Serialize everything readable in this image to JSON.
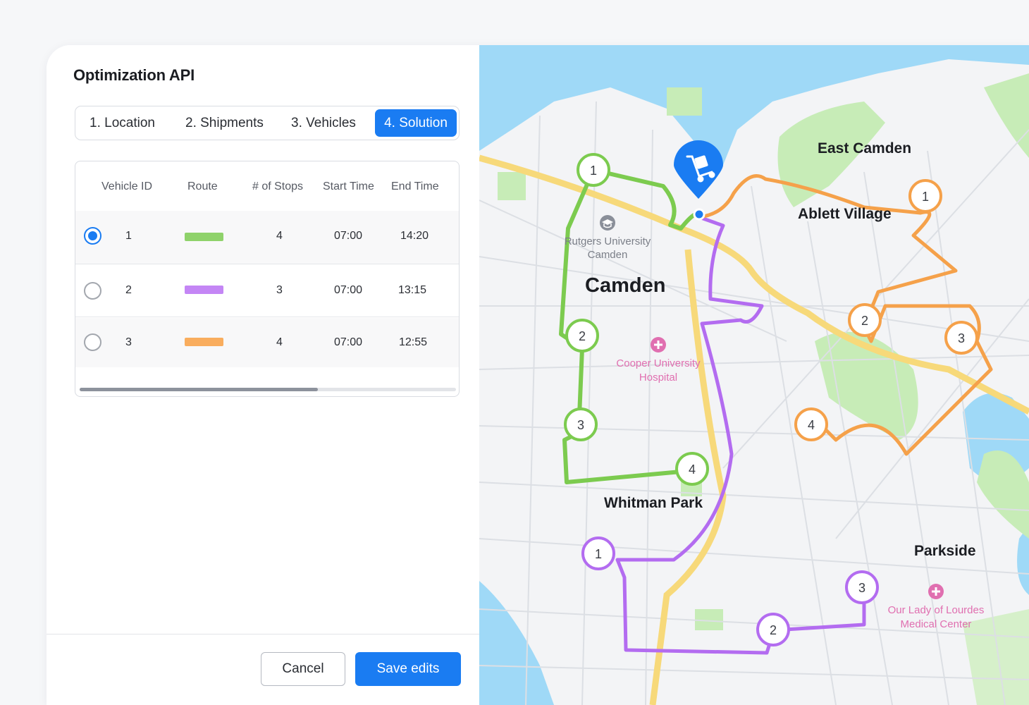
{
  "app": {
    "title": "Optimization API"
  },
  "tabs": [
    {
      "label": "1. Location"
    },
    {
      "label": "2. Shipments"
    },
    {
      "label": "3. Vehicles"
    },
    {
      "label": "4. Solution",
      "active": true
    }
  ],
  "table": {
    "headers": [
      "Vehicle ID",
      "Route",
      "# of Stops",
      "Start Time",
      "End Time"
    ],
    "rows": [
      {
        "vehicle_id": "1",
        "route_color": "#8fd26b",
        "stops": "4",
        "start": "07:00",
        "end": "14:20",
        "selected": true
      },
      {
        "vehicle_id": "2",
        "route_color": "#c486f5",
        "stops": "3",
        "start": "07:00",
        "end": "13:15",
        "selected": false
      },
      {
        "vehicle_id": "3",
        "route_color": "#f9ad5e",
        "stops": "4",
        "start": "07:00",
        "end": "12:55",
        "selected": false
      }
    ]
  },
  "footer": {
    "cancel_label": "Cancel",
    "save_label": "Save edits"
  },
  "map": {
    "labels": {
      "east_camden": "East Camden",
      "ablett_village": "Ablett Village",
      "camden": "Camden",
      "rutgers_1": "Rutgers University",
      "rutgers_2": "Camden",
      "cooper_1": "Cooper University",
      "cooper_2": "Hospital",
      "whitman_park": "Whitman Park",
      "parkside": "Parkside",
      "lourdes_1": "Our Lady of Lourdes",
      "lourdes_2": "Medical Center"
    },
    "stop_numbers": {
      "green": [
        "1",
        "2",
        "3",
        "4"
      ],
      "purple": [
        "1",
        "2",
        "3"
      ],
      "orange": [
        "1",
        "2",
        "3",
        "4"
      ]
    },
    "colors": {
      "green": "#7ccb4f",
      "purple": "#b36cf0",
      "orange": "#f5a14a",
      "depot": "#1a7cf2",
      "water": "#9fd9f7",
      "park": "#c7ecb7",
      "highway": "#f7d97a",
      "poi_pink": "#e06fb0",
      "poi_gray": "#8a8f99"
    },
    "icons": [
      "cart-icon",
      "graduation-cap-icon",
      "hospital-cross-icon"
    ]
  }
}
